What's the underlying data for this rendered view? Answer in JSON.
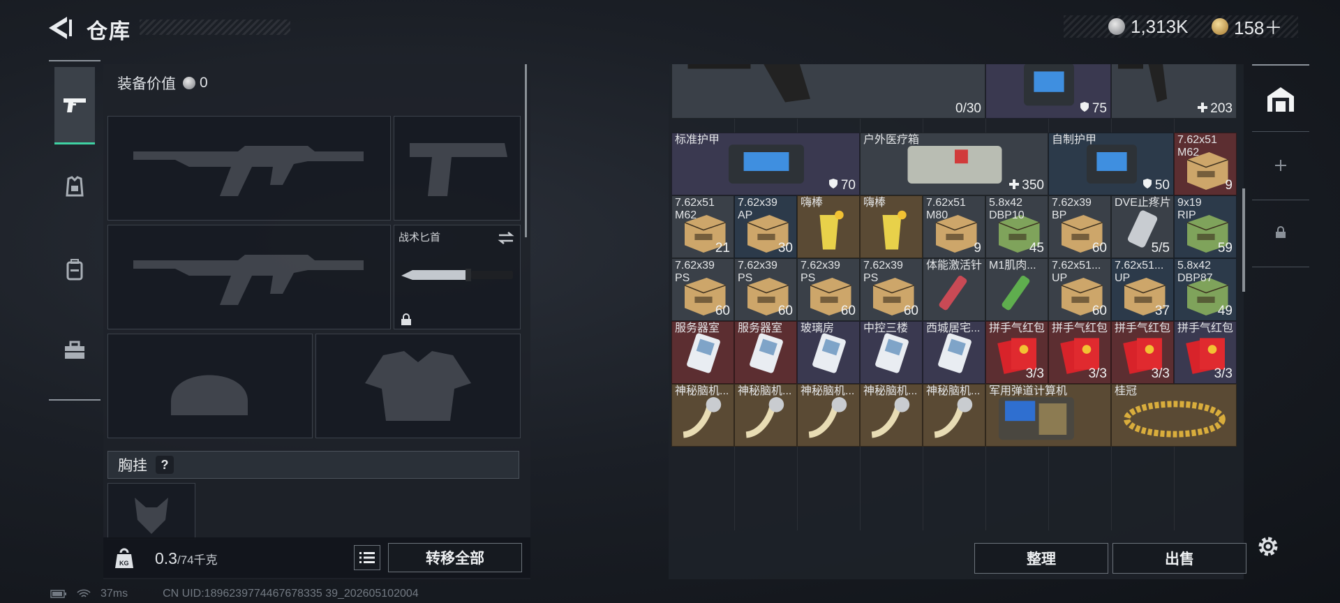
{
  "header": {
    "title": "仓库"
  },
  "currency": [
    {
      "icon": "silver-coin-icon",
      "value": "1,313K"
    },
    {
      "icon": "gold-coin-icon",
      "value": "158＋"
    }
  ],
  "loadout": {
    "value_label": "装备价值",
    "value": "0",
    "melee_slot_label": "战术匕首",
    "rig_section_label": "胸挂",
    "help_glyph": "?",
    "weight_current": "0.3",
    "weight_max": "/74千克",
    "kg_label": "KG",
    "transfer_all_label": "转移全部"
  },
  "status_bar": {
    "ping": "37ms",
    "uid": "CN UID:1896239774467678335 39_202605102004"
  },
  "stash": {
    "sort_label": "整理",
    "sell_label": "出售",
    "items": [
      {
        "name": "",
        "count": "0/30",
        "color": "gray"
      },
      {
        "name": "标准护甲",
        "count": "75",
        "color": "purple",
        "stat": "shield"
      },
      {
        "name": "",
        "count": "203",
        "color": "gray",
        "stat": "heal"
      },
      {
        "name": "标准护甲",
        "count": "70",
        "color": "purple",
        "stat": "shield"
      },
      {
        "name": "户外医疗箱",
        "count": "350",
        "color": "gray",
        "stat": "heal"
      },
      {
        "name": "自制护甲",
        "count": "50",
        "color": "blue",
        "stat": "shield"
      },
      {
        "name": "7.62x51",
        "name2": "M62",
        "count": "9",
        "color": "red"
      },
      {
        "name": "7.62x51",
        "name2": "M62",
        "count": "21",
        "color": "gray"
      },
      {
        "name": "7.62x39",
        "name2": "AP",
        "count": "30",
        "color": "blue"
      },
      {
        "name": "嗨棒",
        "count": "",
        "color": "gold"
      },
      {
        "name": "嗨棒",
        "count": "",
        "color": "gold"
      },
      {
        "name": "7.62x51",
        "name2": "M80",
        "count": "9",
        "color": "gray"
      },
      {
        "name": "5.8x42",
        "name2": "DBP10",
        "count": "45",
        "color": "gray"
      },
      {
        "name": "7.62x39",
        "name2": "BP",
        "count": "60",
        "color": "gray"
      },
      {
        "name": "DVE止疼片",
        "count": "5/5",
        "color": "gray"
      },
      {
        "name": "9x19",
        "name2": "RIP",
        "count": "59",
        "color": "blue"
      },
      {
        "name": "7.62x39",
        "name2": "PS",
        "count": "60",
        "color": "gray"
      },
      {
        "name": "7.62x39",
        "name2": "PS",
        "count": "60",
        "color": "gray"
      },
      {
        "name": "7.62x39",
        "name2": "PS",
        "count": "60",
        "color": "gray"
      },
      {
        "name": "7.62x39",
        "name2": "PS",
        "count": "60",
        "color": "gray"
      },
      {
        "name": "体能激活针",
        "count": "",
        "color": "gray"
      },
      {
        "name": "M1肌肉...",
        "count": "",
        "color": "gray"
      },
      {
        "name": "7.62x51...",
        "name2": "UP",
        "count": "60",
        "color": "gray"
      },
      {
        "name": "7.62x51...",
        "name2": "UP",
        "count": "37",
        "color": "blue"
      },
      {
        "name": "5.8x42",
        "name2": "DBP87",
        "count": "49",
        "color": "blue"
      },
      {
        "name": "服务器室",
        "count": "",
        "color": "red"
      },
      {
        "name": "服务器室",
        "count": "",
        "color": "red"
      },
      {
        "name": "玻璃房",
        "count": "",
        "color": "purple"
      },
      {
        "name": "中控三楼",
        "count": "",
        "color": "purple"
      },
      {
        "name": "西城居宅...",
        "count": "",
        "color": "purple"
      },
      {
        "name": "拼手气红包",
        "count": "3/3",
        "color": "red"
      },
      {
        "name": "拼手气红包",
        "count": "3/3",
        "color": "red"
      },
      {
        "name": "拼手气红包",
        "count": "3/3",
        "color": "red"
      },
      {
        "name": "拼手气红包",
        "count": "3/3",
        "color": "purple"
      },
      {
        "name": "神秘脑机...",
        "count": "",
        "color": "gold"
      },
      {
        "name": "神秘脑机...",
        "count": "",
        "color": "gold"
      },
      {
        "name": "神秘脑机...",
        "count": "",
        "color": "gold"
      },
      {
        "name": "神秘脑机...",
        "count": "",
        "color": "gold"
      },
      {
        "name": "神秘脑机...",
        "count": "",
        "color": "gold"
      },
      {
        "name": "军用弹道计算机",
        "count": "",
        "color": "gold"
      },
      {
        "name": "桂冠",
        "count": "",
        "color": "gold"
      }
    ]
  },
  "colors": {
    "accent": "#3fd2a3",
    "panel": "#1e2229",
    "gold_cell": "#5a4a34",
    "red_cell": "#5c2e31",
    "blue_cell": "#2c3a4a",
    "purple_cell": "#3a3950"
  }
}
